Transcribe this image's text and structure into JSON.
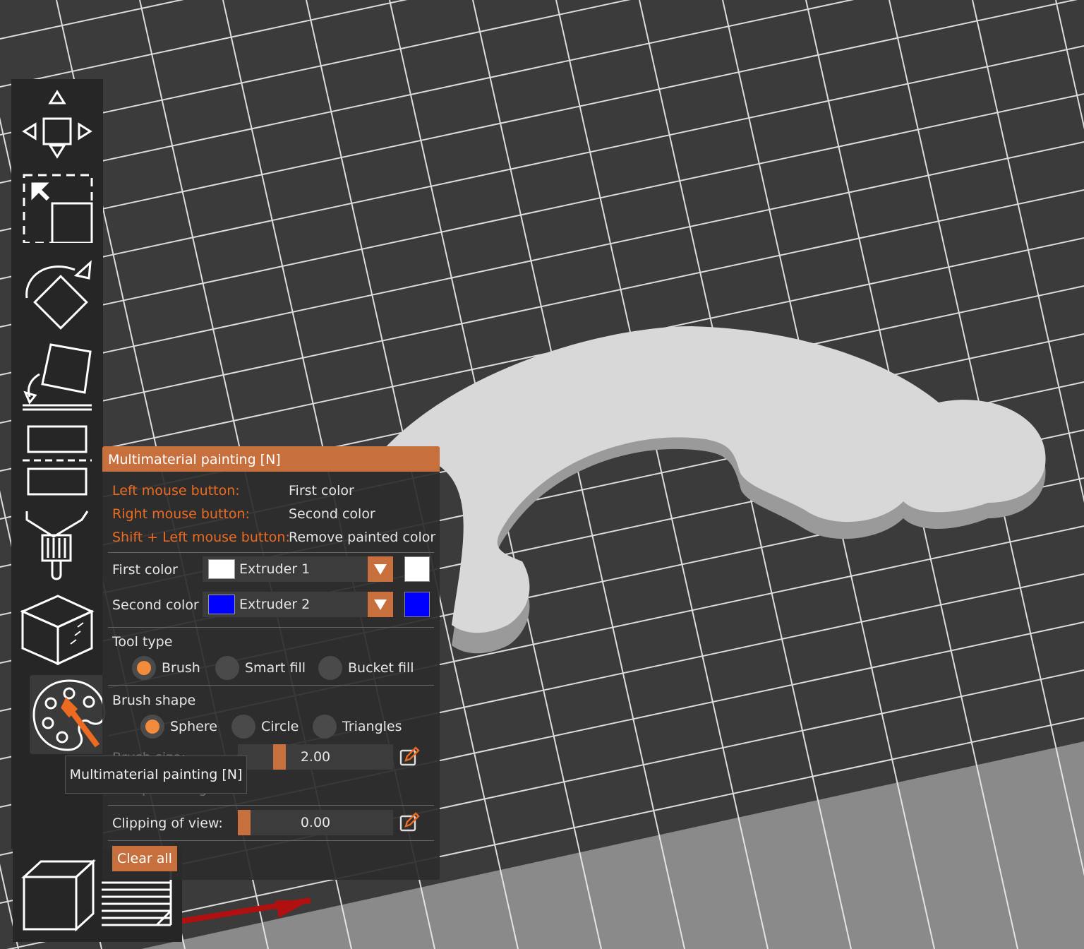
{
  "panel": {
    "title": "Multimaterial painting [N]",
    "hints": [
      {
        "key": "Left mouse button:",
        "action": "First color"
      },
      {
        "key": "Right mouse button:",
        "action": "Second color"
      },
      {
        "key": "Shift + Left mouse button:",
        "action": "Remove painted color"
      }
    ],
    "first_color": {
      "label": "First color",
      "value": "Extruder 1",
      "color": "#ffffff"
    },
    "second_color": {
      "label": "Second color",
      "value": "Extruder 2",
      "color": "#0000ff"
    },
    "tool_type": {
      "label": "Tool type",
      "options": [
        "Brush",
        "Smart fill",
        "Bucket fill"
      ],
      "selected": "Brush"
    },
    "brush_shape": {
      "label": "Brush shape",
      "options": [
        "Sphere",
        "Circle",
        "Triangles"
      ],
      "selected": "Sphere"
    },
    "brush_size": {
      "label": "Brush size:",
      "value": "2.00"
    },
    "split_triangles": {
      "label": "Split triangles",
      "checked": true
    },
    "clipping": {
      "label": "Clipping of view:",
      "value": "0.00"
    },
    "clear_all": "Clear all"
  },
  "tooltip": "Multimaterial painting [N]",
  "toolbar": [
    "move-icon",
    "scale-icon",
    "rotate-icon",
    "place-on-face-icon",
    "cut-icon",
    "support-painting-icon",
    "seam-painting-icon",
    "multimaterial-painting-icon"
  ],
  "colors": {
    "accent": "#c8703d",
    "hint": "#ed6b21",
    "radio_on": "#f28b3c",
    "bed": "#3a3a3a",
    "grid": "#e8e8e8",
    "model": "#d6d6d6"
  }
}
